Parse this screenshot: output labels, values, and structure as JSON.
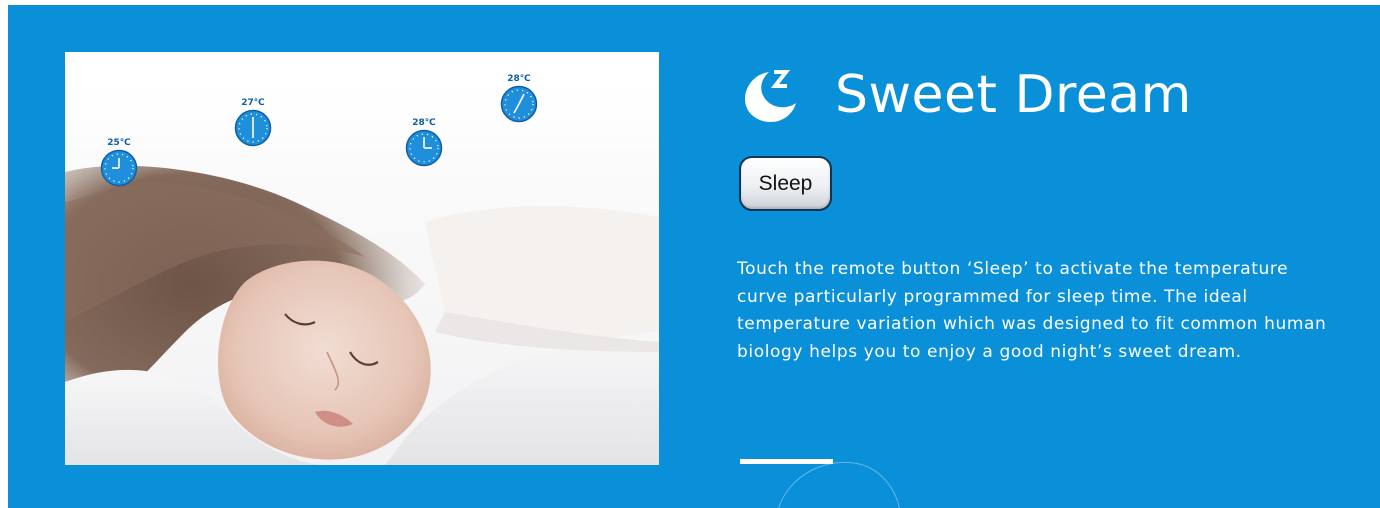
{
  "feature": {
    "title": "Sweet Dream",
    "title_icon": "moon-sleep-icon",
    "button_label": "Sleep",
    "description": "Touch the remote button ‘Sleep’ to activate the temperature curve particularly programmed for sleep time. The ideal temperature variation which was designed to fit common human biology helps you to enjoy a good night’s sweet dream."
  },
  "image": {
    "subject": "sleeping-woman-photo",
    "clock_markers": [
      {
        "temp": "25℃",
        "icon": "clock-icon"
      },
      {
        "temp": "27℃",
        "icon": "clock-icon"
      },
      {
        "temp": "28℃",
        "icon": "clock-icon"
      },
      {
        "temp": "28℃",
        "icon": "clock-icon"
      }
    ]
  },
  "colors": {
    "background": "#0a90d8",
    "text": "#ffffff",
    "accent_bar": "#ffffff",
    "clock_face": "#1f8fdc",
    "clock_label": "#0d5fa8"
  }
}
